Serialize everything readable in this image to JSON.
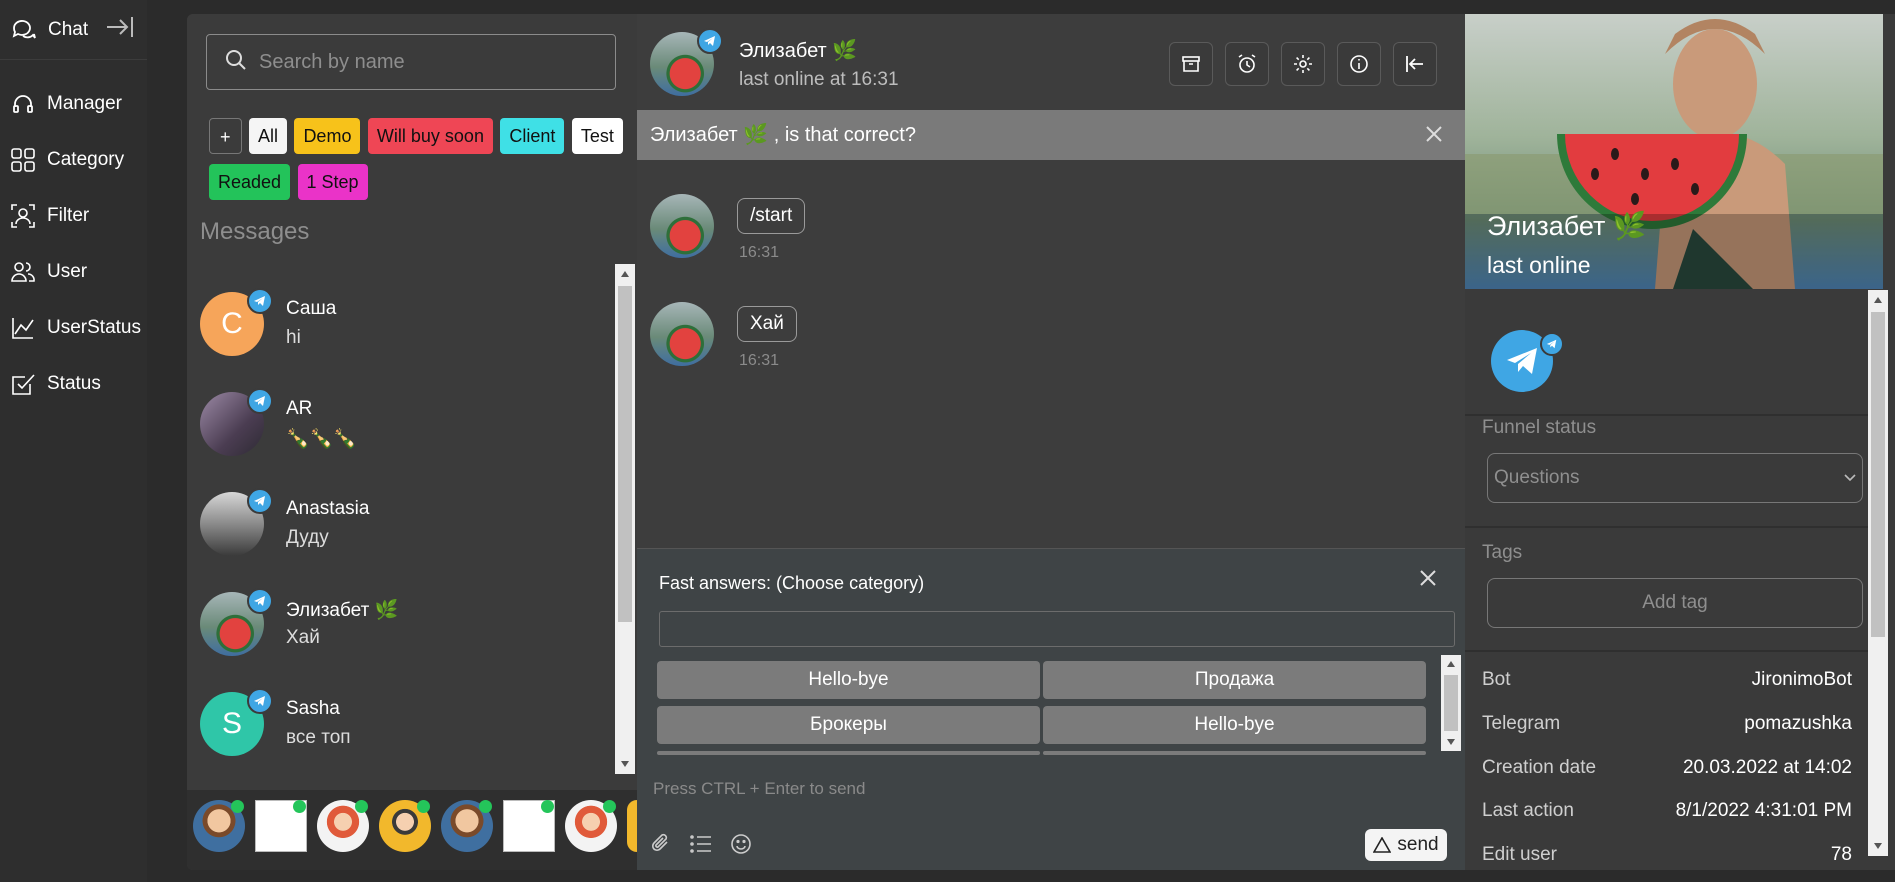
{
  "nav": {
    "chat_label": "Chat",
    "items": [
      {
        "label": "Manager",
        "icon": "headset-icon"
      },
      {
        "label": "Category",
        "icon": "grid-icon"
      },
      {
        "label": "Filter",
        "icon": "filter-person-icon"
      },
      {
        "label": "User",
        "icon": "users-icon"
      },
      {
        "label": "UserStatus",
        "icon": "line-chart-icon"
      },
      {
        "label": "Status",
        "icon": "checkbox-icon"
      }
    ]
  },
  "search": {
    "placeholder": "Search by name"
  },
  "filters": {
    "add_label": "+",
    "tags": [
      {
        "label": "All",
        "color": "#f5f5f5"
      },
      {
        "label": "Demo",
        "color": "#f7c21a"
      },
      {
        "label": "Will buy soon",
        "color": "#ef4655"
      },
      {
        "label": "Client",
        "color": "#3fe0e6"
      },
      {
        "label": "Test",
        "color": "#ffffff"
      },
      {
        "label": "Readed",
        "color": "#23c35a"
      },
      {
        "label": "1 Step",
        "color": "#ea33c8"
      }
    ]
  },
  "messages_title": "Messages",
  "chats": [
    {
      "name": "Саша",
      "preview": "hi",
      "initial": "C",
      "avatar_color": "#f6a55a"
    },
    {
      "name": "AR",
      "preview": "🍾🍾🍾",
      "initial": "",
      "avatar_color": "#6b5a7a"
    },
    {
      "name": "Anastasia",
      "preview": "Дуду",
      "initial": "",
      "avatar_color": "#7a7a7a"
    },
    {
      "name": "Элизабет 🌿",
      "preview": "Хай",
      "initial": "",
      "avatar_color": "#4a8fb0"
    },
    {
      "name": "Sasha",
      "preview": "все топ",
      "initial": "S",
      "avatar_color": "#2fc6a8"
    }
  ],
  "conversation": {
    "name": "Элизабет 🌿",
    "status": "last online at 16:31",
    "confirm_text": "Элизабет 🌿 , is that correct?",
    "header_buttons": [
      "archive-icon",
      "alarm-icon",
      "gear-icon",
      "info-icon",
      "collapse-left-icon"
    ],
    "messages": [
      {
        "text": "/start",
        "time": "16:31"
      },
      {
        "text": "Хай",
        "time": "16:31"
      }
    ]
  },
  "fast_answers": {
    "title": "Fast answers: (Choose category)",
    "buttons": [
      "Hello-bye",
      "Продажа",
      "Брокеры",
      "Hello-bye"
    ]
  },
  "composer": {
    "placeholder": "Press CTRL + Enter to send",
    "send_label": "send"
  },
  "profile": {
    "name": "Элизабет 🌿",
    "status": "last online",
    "funnel_label": "Funnel status",
    "funnel_value": "Questions",
    "tags_label": "Tags",
    "add_tag_label": "Add tag",
    "details": [
      {
        "key": "Bot",
        "value": "JironimoBot"
      },
      {
        "key": "Telegram",
        "value": "pomazushka"
      },
      {
        "key": "Creation date",
        "value": "20.03.2022 at 14:02"
      },
      {
        "key": "Last action",
        "value": "8/1/2022 4:31:01 PM"
      },
      {
        "key": "Edit user",
        "value": "78"
      }
    ]
  }
}
